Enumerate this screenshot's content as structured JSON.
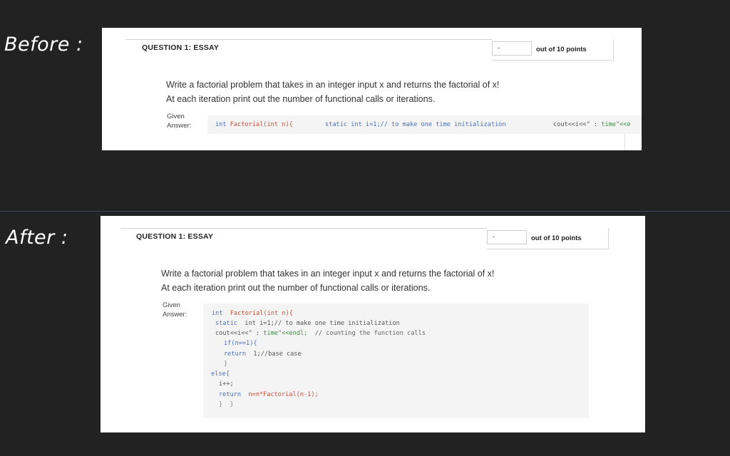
{
  "labels": {
    "before": "Before :",
    "after": "After :"
  },
  "question": {
    "title": "QUESTION 1:  ESSAY",
    "score_value": "-",
    "score_label": "out of 10 points",
    "text_line1": "Write a factorial problem that takes in an integer input x and returns the factorial of x!",
    "text_line2": "At each iteration print out the number of functional calls or iterations.",
    "given_line1": "Given",
    "given_line2": "Answer:"
  },
  "before_code": {
    "seg1a": "int",
    "seg1b": " Factorial(int n){",
    "seg2": "static int i=1;// to make one time initialization",
    "seg3a": "cout<<i<<\" : ",
    "seg3b": "time\"<<e"
  },
  "after_code": {
    "l1a": "int",
    "l1b": "  Factorial(int n){",
    "l2a": "static",
    "l2b": "  int i=1;// to make one time initialization",
    "l3a": "cout<<i<<\" : ",
    "l3b": "time\"<<endl;",
    "l3c": "  // counting the function calls",
    "l4a": "if(n==1){",
    "l5a": "return",
    "l5b": "  1;//base case",
    "l6": "}",
    "l7": "else{",
    "l8": "i++;",
    "l9a": "return",
    "l9b": "  n=n*Factorial(n-1);",
    "l10": "}  }"
  }
}
